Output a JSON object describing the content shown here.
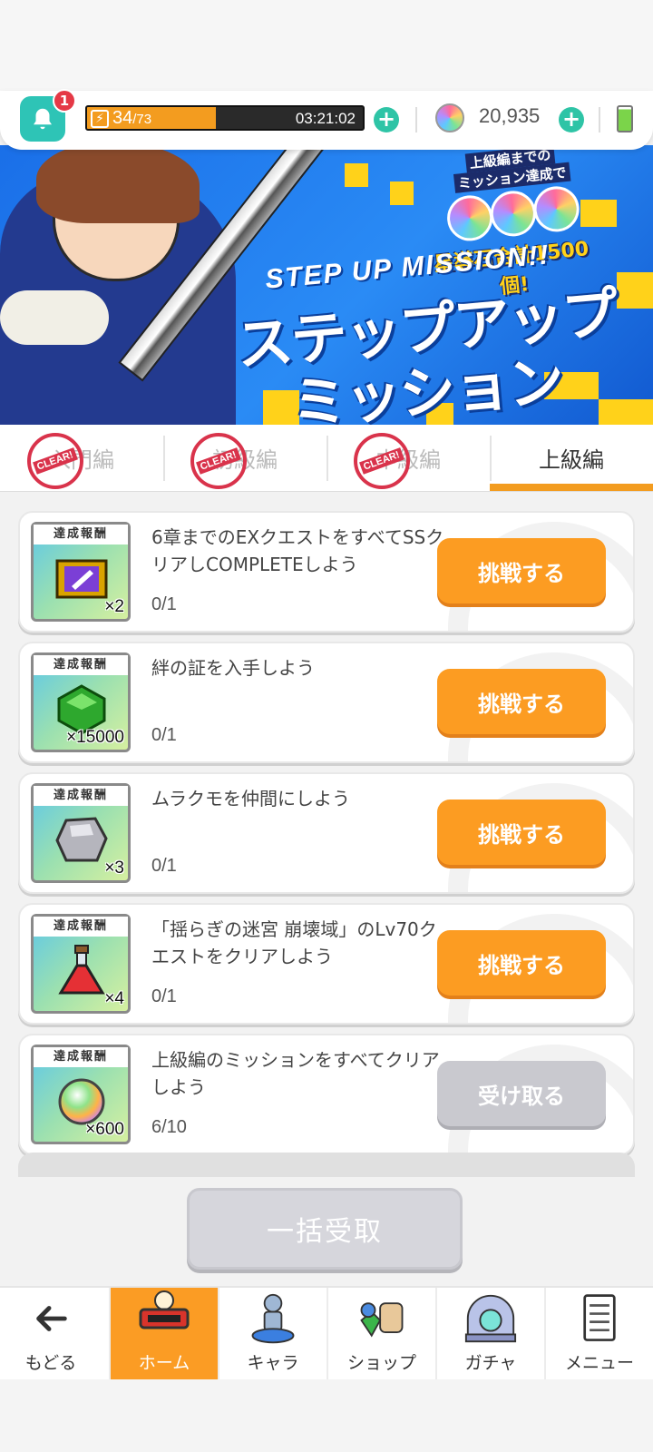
{
  "status": {
    "notification_count": "1",
    "stamina_current": "34",
    "stamina_max": "/73",
    "stamina_fraction": 0.466,
    "timer": "03:21:02",
    "gem_count": "20,935"
  },
  "banner": {
    "english_title": "STEP UP MISSION!!",
    "title_line1": "ステップアップ",
    "title_line2": "ミッション",
    "reward_line1": "上級編までの",
    "reward_line2": "ミッション達成で",
    "reward_total": "星導石合計1500個!"
  },
  "tabs": [
    {
      "label": "入門編",
      "cleared": true,
      "clear_text": "CLEAR!"
    },
    {
      "label": "初級編",
      "cleared": true,
      "clear_text": "CLEAR!"
    },
    {
      "label": "中級編",
      "cleared": true,
      "clear_text": "CLEAR!"
    },
    {
      "label": "上級編",
      "cleared": false,
      "clear_text": ""
    }
  ],
  "reward_label": "達成報酬",
  "missions": [
    {
      "title": "6章までのEXクエストをすべてSSクリアしCOMPLETEしよう",
      "progress": "0/1",
      "reward_qty": "×2",
      "reward_icon": "ticket-icon",
      "button": "挑戦する"
    },
    {
      "title": "絆の証を入手しよう",
      "progress": "0/1",
      "reward_qty": "×15000",
      "reward_icon": "green-crystal-icon",
      "button": "挑戦する"
    },
    {
      "title": "ムラクモを仲間にしよう",
      "progress": "0/1",
      "reward_qty": "×3",
      "reward_icon": "ore-icon",
      "button": "挑戦する"
    },
    {
      "title": "「揺らぎの迷宮 崩壊域」のLv70クエストをクリアしよう",
      "progress": "0/1",
      "reward_qty": "×4",
      "reward_icon": "potion-icon",
      "button": "挑戦する"
    },
    {
      "title": "上級編のミッションをすべてクリアしよう",
      "progress": "6/10",
      "reward_qty": "×600",
      "reward_icon": "star-stone-icon",
      "button": "受け取る"
    }
  ],
  "bulk_button": "一括受取",
  "nav": [
    {
      "label": "もどる",
      "icon": "back-arrow-icon"
    },
    {
      "label": "ホーム",
      "icon": "home-icon"
    },
    {
      "label": "キャラ",
      "icon": "character-icon"
    },
    {
      "label": "ショップ",
      "icon": "shop-icon"
    },
    {
      "label": "ガチャ",
      "icon": "gacha-icon"
    },
    {
      "label": "メニュー",
      "icon": "menu-icon"
    }
  ],
  "colors": {
    "accent": "#fc9c22",
    "teal": "#2ec4b6",
    "banner_blue": "#1a6fe8"
  }
}
